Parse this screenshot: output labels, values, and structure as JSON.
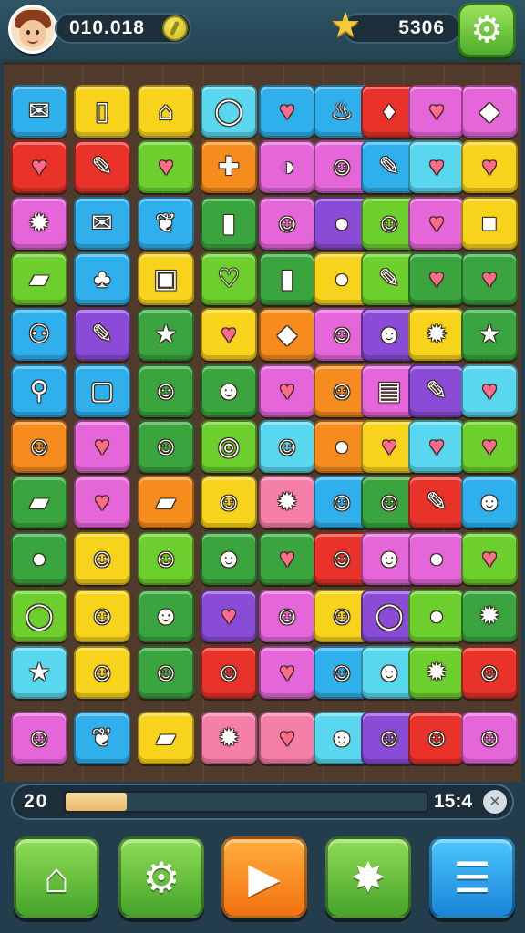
{
  "header": {
    "score": "010.018",
    "stars": "5306",
    "icons": {
      "avatar": "player-avatar",
      "coin": "coin-icon",
      "star": "star-icon",
      "settings": "gear-icon"
    }
  },
  "footer": {
    "level": "20",
    "timer": "15:4",
    "progress": 0.17,
    "buttons": [
      {
        "name": "home-button",
        "icon": "home-icon",
        "glyph": "⌂",
        "color": "green"
      },
      {
        "name": "settings-button",
        "icon": "gear-icon",
        "glyph": "⚙",
        "color": "green"
      },
      {
        "name": "play-button",
        "icon": "play-icon",
        "glyph": "▶",
        "color": "orange"
      },
      {
        "name": "power-button",
        "icon": "splat-icon",
        "glyph": "✸",
        "color": "green"
      },
      {
        "name": "menu-button",
        "icon": "menu-icon",
        "glyph": "☰",
        "color": "blue"
      }
    ]
  },
  "palette": {
    "b": "#2fb0ec",
    "y": "#f7d31c",
    "r": "#e8322a",
    "p": "#e466d9",
    "g": "#6ccf2d",
    "G": "#3aa43f",
    "o": "#f58c1d",
    "v": "#8a4bd6",
    "c": "#58d7ef",
    "k": "#f57fa8"
  },
  "board": {
    "rows": [
      [
        {
          "c": "b",
          "i": "✉"
        },
        {
          "c": "y",
          "i": "▯"
        },
        {
          "c": "y",
          "i": "⌂"
        },
        {
          "c": "c",
          "i": "◯"
        },
        {
          "c": "b",
          "i": "♥"
        },
        {
          "c": "b",
          "i": "♨"
        },
        {
          "c": "r",
          "i": "♦"
        },
        {
          "c": "p",
          "i": "♥"
        },
        {
          "c": "p",
          "i": "◆"
        }
      ],
      [
        {
          "c": "r",
          "i": "♥"
        },
        {
          "c": "r",
          "i": "✎"
        },
        {
          "c": "g",
          "i": "♥"
        },
        {
          "c": "o",
          "i": "✚"
        },
        {
          "c": "p",
          "i": "◑"
        },
        {
          "c": "p",
          "i": "☺"
        },
        {
          "c": "b",
          "i": "✎"
        },
        {
          "c": "c",
          "i": "♥"
        },
        {
          "c": "y",
          "i": "♥"
        }
      ],
      [
        {
          "c": "p",
          "i": "✹"
        },
        {
          "c": "b",
          "i": "✉"
        },
        {
          "c": "b",
          "i": "❦"
        },
        {
          "c": "G",
          "i": "▮"
        },
        {
          "c": "p",
          "i": "☺"
        },
        {
          "c": "v",
          "i": "●"
        },
        {
          "c": "g",
          "i": "☺"
        },
        {
          "c": "p",
          "i": "♥"
        },
        {
          "c": "y",
          "i": "■"
        }
      ],
      [
        {
          "c": "g",
          "i": "▰"
        },
        {
          "c": "b",
          "i": "♣"
        },
        {
          "c": "y",
          "i": "▣"
        },
        {
          "c": "g",
          "i": "♡"
        },
        {
          "c": "G",
          "i": "▮"
        },
        {
          "c": "y",
          "i": "●"
        },
        {
          "c": "g",
          "i": "✎"
        },
        {
          "c": "G",
          "i": "♥"
        },
        {
          "c": "G",
          "i": "♥"
        }
      ],
      [
        {
          "c": "b",
          "i": "⚇"
        },
        {
          "c": "v",
          "i": "✎"
        },
        {
          "c": "G",
          "i": "★"
        },
        {
          "c": "y",
          "i": "♥"
        },
        {
          "c": "o",
          "i": "◆"
        },
        {
          "c": "p",
          "i": "☺"
        },
        {
          "c": "v",
          "i": "☻"
        },
        {
          "c": "y",
          "i": "✹"
        },
        {
          "c": "G",
          "i": "★"
        }
      ],
      [
        {
          "c": "b",
          "i": "⚲"
        },
        {
          "c": "b",
          "i": "▢"
        },
        {
          "c": "G",
          "i": "☺"
        },
        {
          "c": "G",
          "i": "☻"
        },
        {
          "c": "p",
          "i": "♥"
        },
        {
          "c": "o",
          "i": "☺"
        },
        {
          "c": "p",
          "i": "▤"
        },
        {
          "c": "v",
          "i": "✎"
        },
        {
          "c": "c",
          "i": "♥"
        }
      ],
      [
        {
          "c": "o",
          "i": "☺"
        },
        {
          "c": "p",
          "i": "♥"
        },
        {
          "c": "G",
          "i": "☺"
        },
        {
          "c": "g",
          "i": "◎"
        },
        {
          "c": "c",
          "i": "☺"
        },
        {
          "c": "o",
          "i": "●"
        },
        {
          "c": "y",
          "i": "♥"
        },
        {
          "c": "c",
          "i": "♥"
        },
        {
          "c": "g",
          "i": "♥"
        }
      ],
      [
        {
          "c": "G",
          "i": "▰"
        },
        {
          "c": "p",
          "i": "♥"
        },
        {
          "c": "o",
          "i": "▰"
        },
        {
          "c": "y",
          "i": "☺"
        },
        {
          "c": "k",
          "i": "✹"
        },
        {
          "c": "b",
          "i": "☺"
        },
        {
          "c": "G",
          "i": "☺"
        },
        {
          "c": "r",
          "i": "✎"
        },
        {
          "c": "b",
          "i": "☻"
        }
      ],
      [
        {
          "c": "G",
          "i": "●"
        },
        {
          "c": "y",
          "i": "☺"
        },
        {
          "c": "g",
          "i": "☺"
        },
        {
          "c": "G",
          "i": "☻"
        },
        {
          "c": "G",
          "i": "♥"
        },
        {
          "c": "r",
          "i": "☺"
        },
        {
          "c": "p",
          "i": "☻"
        },
        {
          "c": "p",
          "i": "●"
        },
        {
          "c": "g",
          "i": "♥"
        }
      ],
      [
        {
          "c": "g",
          "i": "◯"
        },
        {
          "c": "y",
          "i": "☺"
        },
        {
          "c": "G",
          "i": "☻"
        },
        {
          "c": "v",
          "i": "♥"
        },
        {
          "c": "p",
          "i": "☺"
        },
        {
          "c": "y",
          "i": "☺"
        },
        {
          "c": "v",
          "i": "◯"
        },
        {
          "c": "g",
          "i": "●"
        },
        {
          "c": "G",
          "i": "✹"
        }
      ],
      [
        {
          "c": "c",
          "i": "★"
        },
        {
          "c": "y",
          "i": "☺"
        },
        {
          "c": "G",
          "i": "☺"
        },
        {
          "c": "r",
          "i": "☺"
        },
        {
          "c": "p",
          "i": "♥"
        },
        {
          "c": "b",
          "i": "☺"
        },
        {
          "c": "c",
          "i": "☻"
        },
        {
          "c": "g",
          "i": "✹"
        },
        {
          "c": "r",
          "i": "☺"
        }
      ],
      [
        {
          "c": "p",
          "i": "☺"
        },
        {
          "c": "b",
          "i": "❦"
        },
        {
          "c": "y",
          "i": "▰"
        },
        {
          "c": "k",
          "i": "✹"
        },
        {
          "c": "k",
          "i": "♥"
        },
        {
          "c": "c",
          "i": "☻"
        },
        {
          "c": "v",
          "i": "☺"
        },
        {
          "c": "r",
          "i": "☺"
        },
        {
          "c": "p",
          "i": "☺"
        }
      ]
    ]
  }
}
